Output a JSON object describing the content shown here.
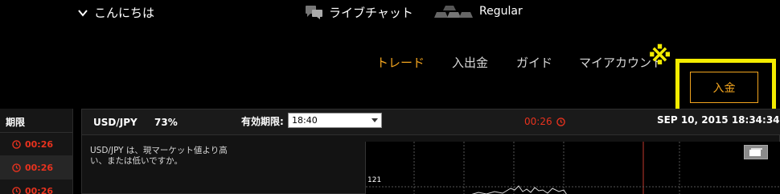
{
  "topbar": {
    "greeting": "こんにちは",
    "live_chat": "ライブチャット",
    "account_level": "Regular"
  },
  "nav": {
    "items": [
      {
        "label": "トレード",
        "active": true
      },
      {
        "label": "入出金",
        "active": false
      },
      {
        "label": "ガイド",
        "active": false
      },
      {
        "label": "マイアカウント",
        "active": false
      }
    ],
    "deposit_button": "入金",
    "annotation_mark": "※"
  },
  "left_panel": {
    "header": "期限",
    "rows": [
      "00:26",
      "00:26",
      "00:26"
    ]
  },
  "trade_panel": {
    "pair": "USD/JPY",
    "payout": "73%",
    "expiry_label": "有効期限:",
    "expiry_value": "18:40",
    "countdown": "00:26",
    "datetime": "SEP 10, 2015 18:34:34",
    "question": "USD/JPY は、現マーケット値より高い、または低いですか。",
    "chart_price_label": "121"
  },
  "colors": {
    "accent": "#f2a41e",
    "highlight": "#f4ec00",
    "timer_red": "#e8321e"
  }
}
